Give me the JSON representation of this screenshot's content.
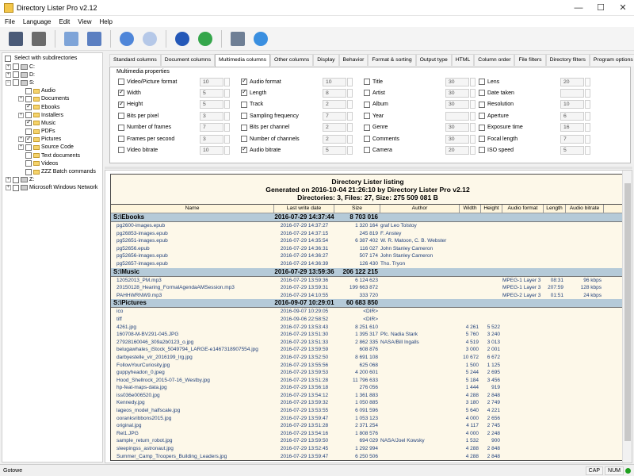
{
  "window": {
    "title": "Directory Lister Pro v2.12",
    "min": "—",
    "max": "☐",
    "close": "✕"
  },
  "menu": [
    "File",
    "Language",
    "Edit",
    "View",
    "Help"
  ],
  "toolbar": [
    {
      "icon": "floppy-save-icon",
      "color": "#4b5b78"
    },
    {
      "icon": "printer-icon",
      "color": "#6b6b6b"
    },
    {
      "icon": "email-icon",
      "color": "#7ea4d8"
    },
    {
      "icon": "copy-icon",
      "color": "#5b7fc1"
    },
    {
      "icon": "play-icon",
      "color": "#4f86d9"
    },
    {
      "icon": "stop-icon",
      "color": "#b5c8e8"
    },
    {
      "icon": "help-icon",
      "color": "#2458b8"
    },
    {
      "icon": "globe-icon",
      "color": "#35a64b"
    },
    {
      "icon": "basket-icon",
      "color": "#6f7f95"
    },
    {
      "icon": "power-icon",
      "color": "#3a8fe0"
    }
  ],
  "sidebar": {
    "select_label": "Select with subdirectories",
    "tree": [
      {
        "label": "C:",
        "level": 0,
        "type": "drive",
        "checked": false,
        "exp": "+"
      },
      {
        "label": "D:",
        "level": 0,
        "type": "drive",
        "checked": false,
        "exp": "+"
      },
      {
        "label": "S:",
        "level": 0,
        "type": "drive",
        "checked": false,
        "exp": "−"
      },
      {
        "label": "Audio",
        "level": 1,
        "type": "folder",
        "checked": false,
        "exp": ""
      },
      {
        "label": "Documents",
        "level": 1,
        "type": "folder",
        "checked": false,
        "exp": "+"
      },
      {
        "label": "Ebooks",
        "level": 1,
        "type": "folder",
        "checked": true,
        "exp": ""
      },
      {
        "label": "Installers",
        "level": 1,
        "type": "folder",
        "checked": false,
        "exp": "+"
      },
      {
        "label": "Music",
        "level": 1,
        "type": "folder",
        "checked": true,
        "exp": ""
      },
      {
        "label": "PDFs",
        "level": 1,
        "type": "folder",
        "checked": false,
        "exp": ""
      },
      {
        "label": "Pictures",
        "level": 1,
        "type": "folder",
        "checked": true,
        "exp": "+"
      },
      {
        "label": "Source Code",
        "level": 1,
        "type": "folder",
        "checked": false,
        "exp": "+"
      },
      {
        "label": "Text documents",
        "level": 1,
        "type": "folder",
        "checked": false,
        "exp": ""
      },
      {
        "label": "Videos",
        "level": 1,
        "type": "folder",
        "checked": false,
        "exp": ""
      },
      {
        "label": "ZZZ Batch commands",
        "level": 1,
        "type": "folder",
        "checked": false,
        "exp": ""
      },
      {
        "label": "Z:",
        "level": 0,
        "type": "drive",
        "checked": false,
        "exp": "+"
      },
      {
        "label": "Microsoft Windows Network",
        "level": 0,
        "type": "drive",
        "checked": false,
        "exp": "+"
      }
    ]
  },
  "tabs": [
    "Standard columns",
    "Document columns",
    "Multimedia columns",
    "Other columns",
    "Display",
    "Behavior",
    "Format & sorting",
    "Output type",
    "HTML",
    "Column order",
    "File filters",
    "Directory filters",
    "Program options"
  ],
  "active_tab": 2,
  "multimedia": {
    "title": "Multimedia properties",
    "columns": [
      [
        {
          "label": "Video/Picture format",
          "checked": false,
          "value": "10"
        },
        {
          "label": "Width",
          "checked": true,
          "value": "5"
        },
        {
          "label": "Height",
          "checked": true,
          "value": "5"
        },
        {
          "label": "Bits per pixel",
          "checked": false,
          "value": "3"
        },
        {
          "label": "Number of frames",
          "checked": false,
          "value": "7"
        },
        {
          "label": "Frames per second",
          "checked": false,
          "value": "3"
        },
        {
          "label": "Video bitrate",
          "checked": false,
          "value": "10"
        }
      ],
      [
        {
          "label": "Audio format",
          "checked": true,
          "value": "10"
        },
        {
          "label": "Length",
          "checked": true,
          "value": "8"
        },
        {
          "label": "Track",
          "checked": false,
          "value": "2"
        },
        {
          "label": "Sampling frequency",
          "checked": false,
          "value": "7"
        },
        {
          "label": "Bits per channel",
          "checked": false,
          "value": "2"
        },
        {
          "label": "Number of channels",
          "checked": false,
          "value": "2"
        },
        {
          "label": "Audio bitrate",
          "checked": true,
          "value": "5"
        }
      ],
      [
        {
          "label": "Title",
          "checked": false,
          "value": "30"
        },
        {
          "label": "Artist",
          "checked": false,
          "value": "30"
        },
        {
          "label": "Album",
          "checked": false,
          "value": "30"
        },
        {
          "label": "Year",
          "checked": false,
          "value": ""
        },
        {
          "label": "Genre",
          "checked": false,
          "value": "30"
        },
        {
          "label": "Comments",
          "checked": false,
          "value": "30"
        },
        {
          "label": "Camera",
          "checked": false,
          "value": "20"
        }
      ],
      [
        {
          "label": "Lens",
          "checked": false,
          "value": "20"
        },
        {
          "label": "Date taken",
          "checked": false,
          "value": ""
        },
        {
          "label": "Resolution",
          "checked": false,
          "value": "10"
        },
        {
          "label": "Aperture",
          "checked": false,
          "value": "6"
        },
        {
          "label": "Exposure time",
          "checked": false,
          "value": "16"
        },
        {
          "label": "Focal length",
          "checked": false,
          "value": "7"
        },
        {
          "label": "ISO speed",
          "checked": false,
          "value": "5"
        }
      ]
    ]
  },
  "report": {
    "heading1": "Directory Lister listing",
    "heading2": "Generated on 2016-10-04 21:26:10 by Directory Lister Pro v2.12",
    "heading3": "Directories: 3, Files: 27, Size: 275 509 081 B",
    "columns": [
      "Name",
      "Last write date",
      "Size",
      "Author",
      "Width",
      "Height",
      "Audio format",
      "Length",
      "Audio bitrate"
    ],
    "sections": [
      {
        "name": "S:\\Ebooks",
        "date": "2016-07-29 14:37:44",
        "size": "8 703 016",
        "files": [
          [
            "pg2600-images.epub",
            "2016-07-29 14:37:27",
            "1 320 164",
            "graf Leo Tolstoy",
            "",
            "",
            "",
            "",
            ""
          ],
          [
            "pg26853-images.epub",
            "2016-07-29 14:37:15",
            "245 819",
            "F. Anstey",
            "",
            "",
            "",
            "",
            ""
          ],
          [
            "pg52651-images.epub",
            "2016-07-29 14:35:54",
            "6 387 402",
            "W. R. Matoon, C. B. Webster",
            "",
            "",
            "",
            "",
            ""
          ],
          [
            "pg52656.epub",
            "2016-07-29 14:36:31",
            "116 027",
            "John Stanley Cameron",
            "",
            "",
            "",
            "",
            ""
          ],
          [
            "pg52656-images.epub",
            "2016-07-29 14:36:27",
            "507 174",
            "John Stanley Cameron",
            "",
            "",
            "",
            "",
            ""
          ],
          [
            "pg52657-images.epub",
            "2016-07-29 14:36:39",
            "126 430",
            "Tho. Tryon",
            "",
            "",
            "",
            "",
            ""
          ]
        ]
      },
      {
        "name": "S:\\Music",
        "date": "2016-07-29 13:59:36",
        "size": "206 122 215",
        "files": [
          [
            "12052013_PM.mp3",
            "2016-07-29 13:59:36",
            "6 124 623",
            "",
            "",
            "",
            "MPEG-1 Layer 3",
            "08:31",
            "96 kbps"
          ],
          [
            "20150128_Hearing_FormalAgendaAMSession.mp3",
            "2016-07-29 13:59:31",
            "199 663 872",
            "",
            "",
            "",
            "MPEG-1 Layer 3",
            "207:59",
            "128 kbps"
          ],
          [
            "PAHHWRNW9.mp3",
            "2016-07-29 14:10:55",
            "333 720",
            "",
            "",
            "",
            "MPEG-2 Layer 3",
            "01:51",
            "24 kbps"
          ]
        ]
      },
      {
        "name": "S:\\Pictures",
        "date": "2016-09-07 10:29:01",
        "size": "60 683 850",
        "files": [
          [
            "ico",
            "2016-09-07 10:29:05",
            "<DIR>",
            "",
            "",
            "",
            "",
            "",
            ""
          ],
          [
            "tiff",
            "2016-09-06 22:58:52",
            "<DIR>",
            "",
            "",
            "",
            "",
            "",
            ""
          ],
          [
            "4261.jpg",
            "2016-07-29 13:53:43",
            "8 251 610",
            "",
            "4 261",
            "5 522",
            "",
            "",
            ""
          ],
          [
            "160708-M-BV291-045.JPG",
            "2016-07-29 13:51:30",
            "1 395 317",
            "Pfc. Nadia Stark",
            "5 760",
            "3 240",
            "",
            "",
            ""
          ],
          [
            "27928160046_309a2b0123_o.jpg",
            "2016-07-29 13:51:33",
            "2 862 335",
            "NASA/Bill Ingalls",
            "4 519",
            "3 013",
            "",
            "",
            ""
          ],
          [
            "belugawhales_iStock_5049794_LARGE-e1467318907554.jpg",
            "2016-07-29 13:59:59",
            "608 876",
            "",
            "3 000",
            "2 001",
            "",
            "",
            ""
          ],
          [
            "darbyestelle_vir_2016199_lrg.jpg",
            "2016-07-29 13:52:50",
            "8 691 108",
            "",
            "10 672",
            "6 672",
            "",
            "",
            ""
          ],
          [
            "FollowYourCuriosity.jpg",
            "2016-07-29 13:55:56",
            "625 068",
            "",
            "1 500",
            "1 125",
            "",
            "",
            ""
          ],
          [
            "guppyheadon_0.jpeg",
            "2016-07-29 13:59:53",
            "4 200 601",
            "",
            "5 244",
            "2 695",
            "",
            "",
            ""
          ],
          [
            "Hood_Shellrock_2015-07-16_Westby.jpg",
            "2016-07-29 13:51:28",
            "11 796 633",
            "",
            "5 184",
            "3 456",
            "",
            "",
            ""
          ],
          [
            "hp-feat-maps-data.jpg",
            "2016-07-29 13:56:18",
            "276 056",
            "",
            "1 444",
            "919",
            "",
            "",
            ""
          ],
          [
            "iss036e006520.jpg",
            "2016-07-29 13:54:12",
            "1 361 883",
            "",
            "4 288",
            "2 848",
            "",
            "",
            ""
          ],
          [
            "Kennedy.jpg",
            "2016-07-29 13:59:32",
            "1 050 885",
            "",
            "3 180",
            "2 749",
            "",
            "",
            ""
          ],
          [
            "lageos_model_halfscale.jpg",
            "2016-07-29 13:53:55",
            "6 091 596",
            "",
            "5 640",
            "4 221",
            "",
            "",
            ""
          ],
          [
            "ooranksribbons2015.jpg",
            "2016-07-29 13:59:47",
            "1 053 123",
            "",
            "4 000",
            "2 656",
            "",
            "",
            ""
          ],
          [
            "original.jpg",
            "2016-07-29 13:51:28",
            "2 371 254",
            "",
            "4 117",
            "2 745",
            "",
            "",
            ""
          ],
          [
            "Rel1.JPG",
            "2016-07-29 13:54:16",
            "1 808 576",
            "",
            "4 000",
            "2 248",
            "",
            "",
            ""
          ],
          [
            "sample_return_robot.jpg",
            "2016-07-29 13:59:50",
            "694 029",
            "NASA/Joel Kowsky",
            "1 532",
            "900",
            "",
            "",
            ""
          ],
          [
            "sleepingss_astronaut.jpg",
            "2016-07-29 13:52:45",
            "1 292 994",
            "",
            "4 288",
            "2 848",
            "",
            "",
            ""
          ],
          [
            "Summer_Camp_Troopers_Building_Leaders.jpg",
            "2016-07-29 13:59:47",
            "6 250 506",
            "",
            "4 288",
            "2 848",
            "",
            "",
            ""
          ]
        ]
      }
    ]
  },
  "status": {
    "left": "Gotowe",
    "cap": "CAP",
    "num": "NUM"
  }
}
